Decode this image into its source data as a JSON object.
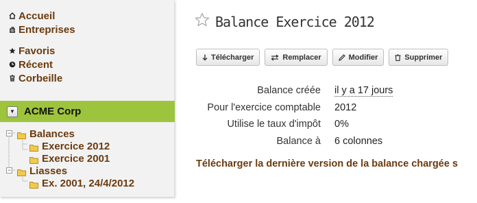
{
  "sidebar": {
    "nav_primary": [
      {
        "label": "Accueil",
        "icon": "home-icon"
      },
      {
        "label": "Entreprises",
        "icon": "building-icon"
      }
    ],
    "nav_secondary": [
      {
        "label": "Favoris",
        "icon": "star-icon"
      },
      {
        "label": "Récent",
        "icon": "clock-icon"
      },
      {
        "label": "Corbeille",
        "icon": "trash-icon"
      }
    ],
    "company": {
      "name": "ACME Corp",
      "toggle_glyph": "▼"
    },
    "tree": {
      "balances": {
        "label": "Balances",
        "children": [
          "Exercice 2012",
          "Exercice 2001"
        ]
      },
      "liasses": {
        "label": "Liasses",
        "children": [
          "Ex. 2001, 24/4/2012"
        ]
      }
    }
  },
  "main": {
    "title": "Balance Exercice 2012",
    "toolbar": {
      "download": "Télécharger",
      "replace": "Remplacer",
      "edit": "Modifier",
      "delete": "Supprimer"
    },
    "details": [
      {
        "label": "Balance créée",
        "value": "il y a 17 jours"
      },
      {
        "label": "Pour l'exercice comptable",
        "value": "2012"
      },
      {
        "label": "Utilise le taux d'impôt",
        "value": "0%"
      },
      {
        "label": "Balance à",
        "value": "6 colonnes"
      }
    ],
    "download_link": "Télécharger la dernière version de la balance chargée s"
  },
  "colors": {
    "link": "#6b3a0e",
    "company_header": "#9dc43c",
    "sidebar_bg": "#f2f2f2",
    "folder": "#f2c94c"
  }
}
